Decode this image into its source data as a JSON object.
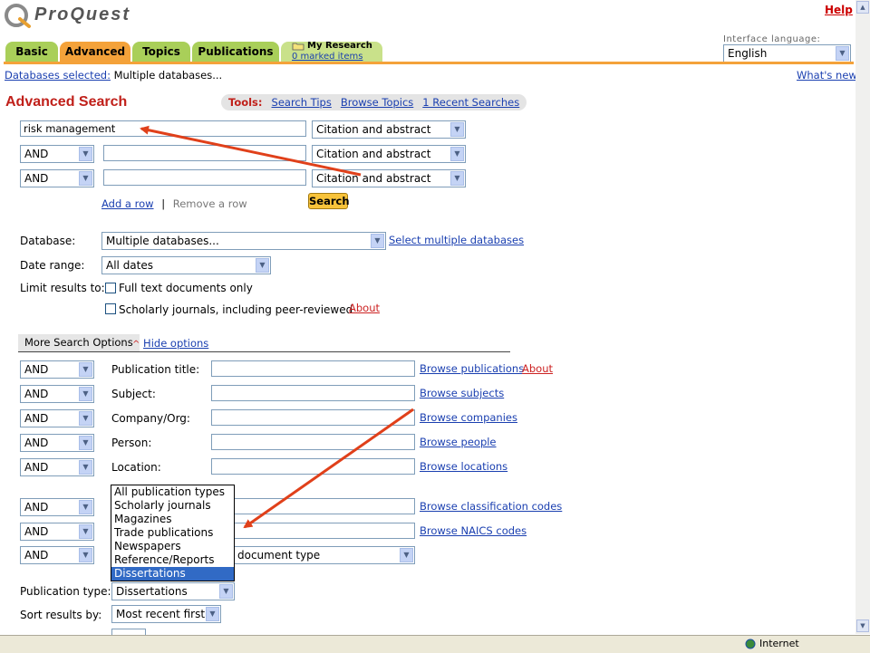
{
  "header": {
    "logo_text": "ProQuest",
    "help": "Help",
    "interface_language_label": "Interface language:",
    "interface_language_value": "English"
  },
  "tabs": {
    "basic": "Basic",
    "advanced": "Advanced",
    "topics": "Topics",
    "publications": "Publications",
    "my_research": "My Research",
    "marked_items": "0 marked items"
  },
  "db_bar": {
    "label": "Databases selected:",
    "value": "Multiple databases...",
    "whats_new": "What's new"
  },
  "page_title": "Advanced Search",
  "tools": {
    "label": "Tools:",
    "search_tips": "Search Tips",
    "browse_topics": "Browse Topics",
    "recent_searches": "1 Recent Searches"
  },
  "search_rows": [
    {
      "operator": "",
      "term": "risk management",
      "field": "Citation and abstract"
    },
    {
      "operator": "AND",
      "term": "",
      "field": "Citation and abstract"
    },
    {
      "operator": "AND",
      "term": "",
      "field": "Citation and abstract"
    }
  ],
  "row_links": {
    "add": "Add a row",
    "sep": "|",
    "remove": "Remove a row"
  },
  "search_button": "Search",
  "database": {
    "label": "Database:",
    "value": "Multiple databases...",
    "link": "Select multiple databases"
  },
  "date_range": {
    "label": "Date range:",
    "value": "All dates"
  },
  "limit": {
    "label": "Limit results to:",
    "full_text": "Full text documents only",
    "scholarly": "Scholarly journals, including peer-reviewed",
    "about": "About"
  },
  "more_options": {
    "tab": "More Search Options",
    "hide": "Hide options"
  },
  "fields": [
    {
      "operator": "AND",
      "label": "Publication title:",
      "link": "Browse publications",
      "extra": "About"
    },
    {
      "operator": "AND",
      "label": "Subject:",
      "link": "Browse subjects"
    },
    {
      "operator": "AND",
      "label": "Company/Org:",
      "link": "Browse companies"
    },
    {
      "operator": "AND",
      "label": "Person:",
      "link": "Browse people"
    },
    {
      "operator": "AND",
      "label": "Location:",
      "link": "Browse locations"
    }
  ],
  "fields2": [
    {
      "operator": "AND",
      "link": "Browse classification codes"
    },
    {
      "operator": "AND",
      "link": "Browse NAICS codes"
    },
    {
      "operator": "AND",
      "select": "document type"
    }
  ],
  "pubtype_list": [
    "All publication types",
    "Scholarly journals",
    "Magazines",
    "Trade publications",
    "Newspapers",
    "Reference/Reports",
    "Dissertations"
  ],
  "publication_type": {
    "label": "Publication type:",
    "value": "Dissertations"
  },
  "sort": {
    "label": "Sort results by:",
    "value": "Most recent first"
  },
  "status": {
    "zone": "Internet"
  },
  "colors": {
    "accent_red": "#c0201a",
    "tab_green": "#a9cf59",
    "tab_orange": "#f4a23a",
    "arrow": "#e0401a"
  }
}
